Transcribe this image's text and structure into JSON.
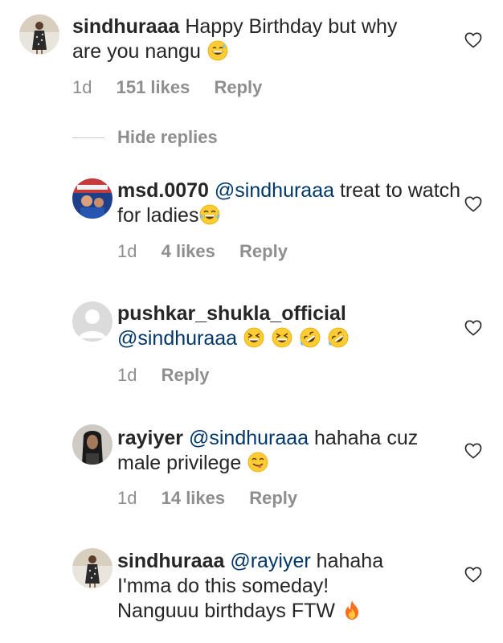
{
  "icons": {
    "heart": "heart-outline-icon",
    "emoji_sweat": "grinning-face-with-sweat",
    "emoji_tears": "face-with-tears-of-joy",
    "emoji_squint": "grinning-squinting-face",
    "emoji_rofl": "rolling-on-the-floor-laughing",
    "emoji_yum": "face-savoring-food",
    "emoji_fire": "fire"
  },
  "colors": {
    "text": "#262626",
    "meta": "#8e8e8e",
    "mention": "#00376b"
  },
  "comment_main": {
    "username": "sindhuraaa",
    "text": "Happy Birthday but why are you nangu",
    "time": "1d",
    "likes": "151 likes",
    "reply": "Reply"
  },
  "hide_replies_label": "Hide replies",
  "replies": [
    {
      "username": "msd.0070",
      "mention": "@sindhuraaa",
      "text": "treat to watch for ladies",
      "time": "1d",
      "likes": "4 likes",
      "reply": "Reply"
    },
    {
      "username": "pushkar_shukla_official",
      "mention": "@sindhuraaa",
      "text": "",
      "time": "1d",
      "reply": "Reply"
    },
    {
      "username": "rayiyer",
      "mention": "@sindhuraaa",
      "text": "hahaha cuz male privilege",
      "time": "1d",
      "likes": "14 likes",
      "reply": "Reply"
    },
    {
      "username": "sindhuraaa",
      "mention": "@rayiyer",
      "text_line1": "hahaha",
      "text_line2": "I'mma do this someday!",
      "text_line3": "Nanguuu birthdays FTW"
    }
  ]
}
